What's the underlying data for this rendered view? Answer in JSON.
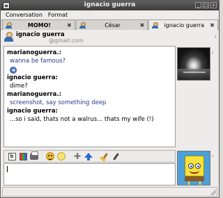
{
  "window": {
    "title": "ignacio guerra"
  },
  "menu": {
    "conversation": "Conversation",
    "format": "Format"
  },
  "tabs": [
    {
      "label": "MOMO!",
      "close": "✖"
    },
    {
      "label": "César",
      "close": "✖"
    },
    {
      "label": "ignacio guerra",
      "close": "✖"
    }
  ],
  "contact": {
    "name": "ignacio guerra",
    "email": "@gmail.com"
  },
  "messages": [
    {
      "nick": "marianoguerra.:",
      "text": "wanna be famous?",
      "style": "blue",
      "nudge": true
    },
    {
      "nick": "ignacio guerra:",
      "text": "dime?",
      "style": "normal"
    },
    {
      "nick": "marianoguerra.:",
      "text": "screenshot, say something deep",
      "style": "blue"
    },
    {
      "nick": "ignacio guerra:",
      "text": "...so i said, thats not a walrus... thats my wife (!)",
      "style": "normal"
    }
  ],
  "toolbar": {
    "icons": [
      "font-icon",
      "color-icon",
      "print-icon",
      "smiley-icon",
      "wink-icon",
      "add-icon",
      "send-file-icon",
      "clear-icon",
      "color-picker-icon"
    ],
    "font_letter": "b"
  },
  "colors": {
    "self_message": "#2a3a8a",
    "titlebar": "#4a4a4a"
  }
}
